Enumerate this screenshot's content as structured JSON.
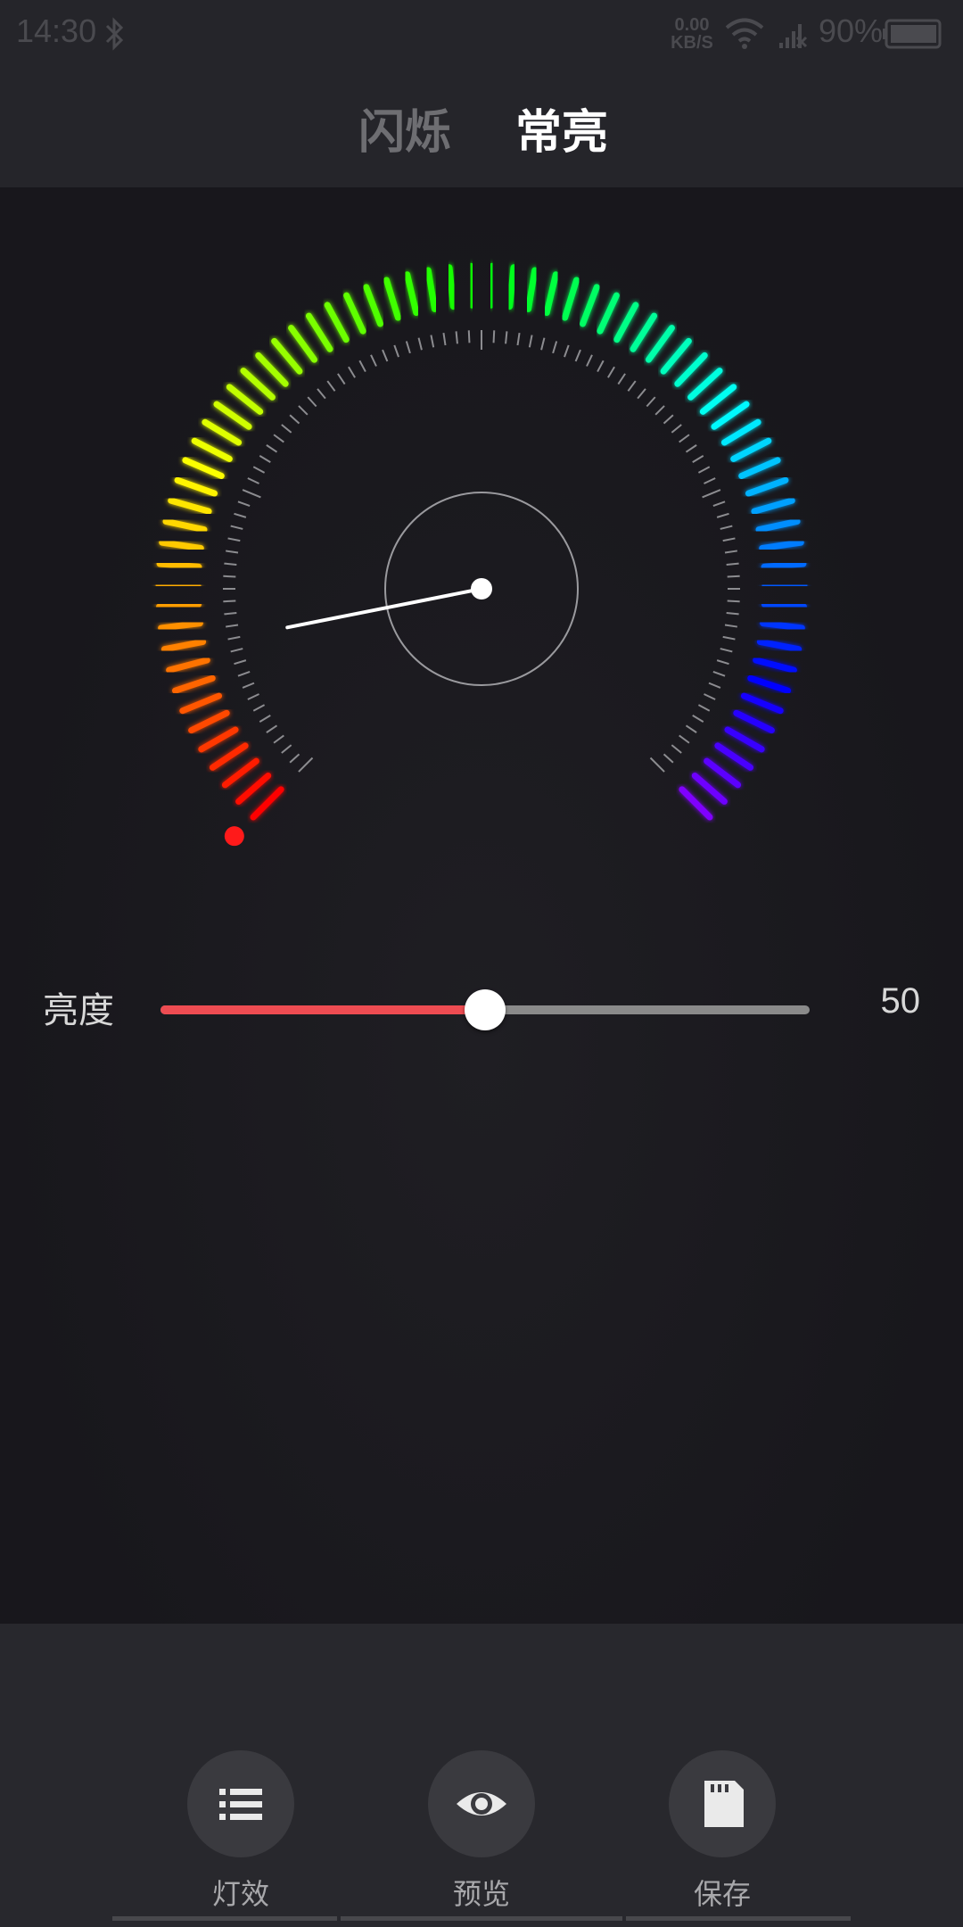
{
  "status_bar": {
    "time": "14:30",
    "network_speed_value": "0.00",
    "network_speed_unit": "KB/S",
    "battery_percent": "90%",
    "icons": [
      "bluetooth-icon",
      "wifi-icon",
      "signal-icon",
      "battery-icon"
    ]
  },
  "tabs": [
    {
      "label": "闪烁",
      "active": false
    },
    {
      "label": "常亮",
      "active": true
    }
  ],
  "gauge": {
    "pointer_value_fraction": 0.125
  },
  "brightness": {
    "label": "亮度",
    "value": "50",
    "fraction": 0.5
  },
  "actions": [
    {
      "label": "灯效",
      "icon": "list-icon"
    },
    {
      "label": "预览",
      "icon": "eye-icon"
    },
    {
      "label": "保存",
      "icon": "sd-card-icon"
    }
  ],
  "colors": {
    "accent": "#ee4c52",
    "background": "#1a191e",
    "bar": "#25252a"
  }
}
